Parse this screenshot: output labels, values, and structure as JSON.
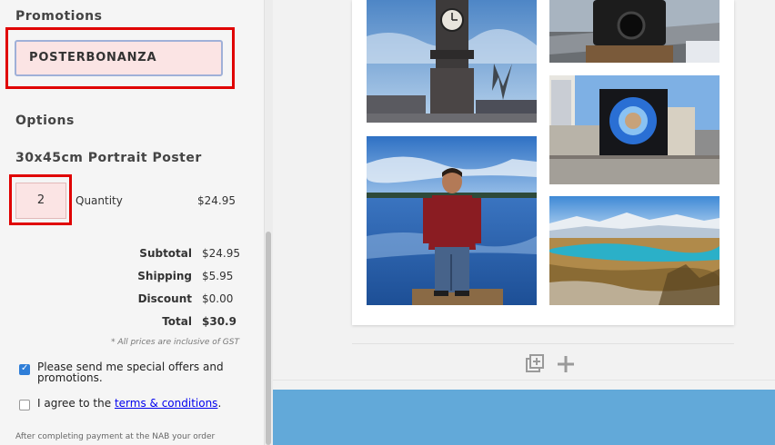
{
  "promotions": {
    "title": "Promotions",
    "code_value": "POSTERBONANZA"
  },
  "options": {
    "title": "Options",
    "product_name": "30x45cm Portrait Poster",
    "quantity_value": "2",
    "quantity_label": "Quantity",
    "unit_price": "$24.95"
  },
  "totals": {
    "subtotal_label": "Subtotal",
    "subtotal_value": "$24.95",
    "shipping_label": "Shipping",
    "shipping_value": "$5.95",
    "discount_label": "Discount",
    "discount_value": "$0.00",
    "total_label": "Total",
    "total_value": "$30.9",
    "gst_note": "* All prices are inclusive of GST"
  },
  "consent": {
    "offers_checked": true,
    "offers_label_1": "Please send me special offers and",
    "offers_label_2": "promotions.",
    "terms_checked": false,
    "terms_prefix": "I agree to the ",
    "terms_link": "terms & conditions",
    "terms_suffix": "."
  },
  "footer_note": "After completing payment at the NAB your order",
  "colors": {
    "highlight_red": "#e00000",
    "blue_band": "#62a9d9",
    "checkbox_blue": "#2f7ed8"
  },
  "icons": {
    "duplicate": "duplicate-page-icon",
    "add": "plus-icon"
  }
}
